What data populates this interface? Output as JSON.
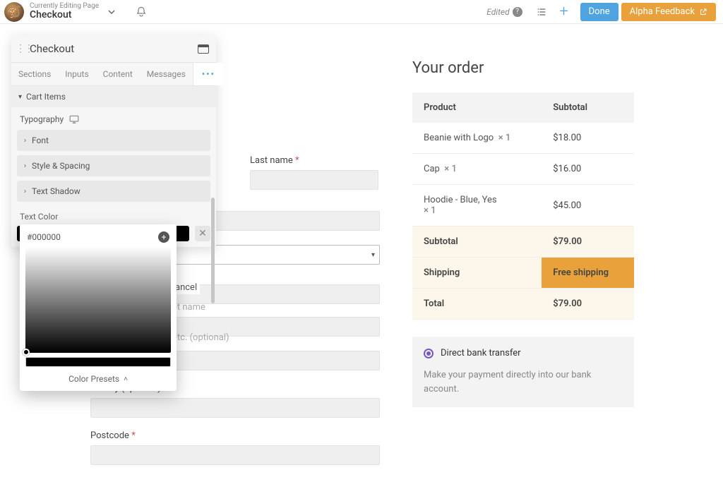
{
  "topbar": {
    "subtitle": "Currently Editing Page",
    "title": "Checkout",
    "edited": "Edited",
    "done": "Done",
    "alpha": "Alpha Feedback"
  },
  "panel": {
    "title": "Checkout",
    "tabs": [
      "Sections",
      "Inputs",
      "Content",
      "Messages"
    ],
    "section": "Cart Items",
    "typography": "Typography",
    "accordion": [
      "Font",
      "Style & Spacing",
      "Text Shadow"
    ],
    "text_color_label": "Text Color",
    "hex": "#000000",
    "presets": "Color Presets"
  },
  "form": {
    "last_name": "Last name",
    "cancel": "ancel",
    "street_frag": "et name",
    "opt_frag": "etc. (optional)",
    "county": "County (optional)",
    "postcode": "Postcode"
  },
  "order": {
    "title": "Your order",
    "headers": {
      "product": "Product",
      "subtotal": "Subtotal"
    },
    "items": [
      {
        "name": "Beanie with Logo",
        "qty": "× 1",
        "price": "$18.00"
      },
      {
        "name": "Cap",
        "qty": "× 1",
        "price": "$16.00"
      },
      {
        "name": "Hoodie - Blue, Yes",
        "qty": "× 1",
        "price": "$45.00"
      }
    ],
    "subtotal_label": "Subtotal",
    "subtotal": "$79.00",
    "shipping_label": "Shipping",
    "shipping": "Free shipping",
    "total_label": "Total",
    "total": "$79.00"
  },
  "payment": {
    "method": "Direct bank transfer",
    "desc": "Make your payment directly into our bank account."
  }
}
